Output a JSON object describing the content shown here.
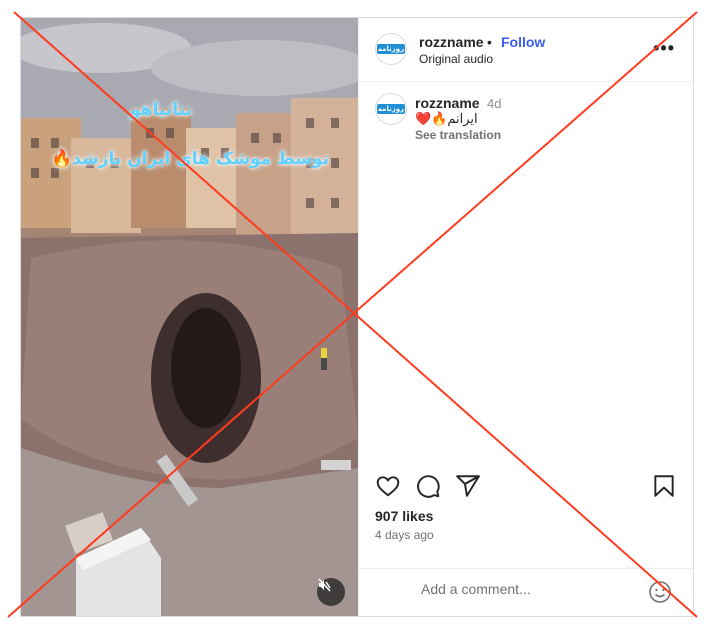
{
  "post": {
    "username": "rozzname",
    "separator": "•",
    "follow_label": "Follow",
    "audio_label": "Original audio",
    "more_label": "•••",
    "avatar_text": "روزنامه",
    "caption": {
      "username": "rozzname",
      "age": "4d",
      "text": "ایرانم🔥❤️",
      "translate_label": "See translation"
    },
    "likes": "907 likes",
    "posted": "4 days ago",
    "comment_placeholder": "Add a comment..."
  },
  "video": {
    "overlay_line1": "نتانیاهو",
    "overlay_line2": "توسط موشک های ایران بازشد🔥"
  },
  "colors": {
    "link_blue": "#3a5ff0",
    "overlay_cross": "#ff3b1f",
    "caption_text": "#5fd0ff"
  },
  "icons": [
    "heart-icon",
    "comment-icon",
    "share-icon",
    "bookmark-icon",
    "emoji-icon",
    "mute-icon"
  ]
}
